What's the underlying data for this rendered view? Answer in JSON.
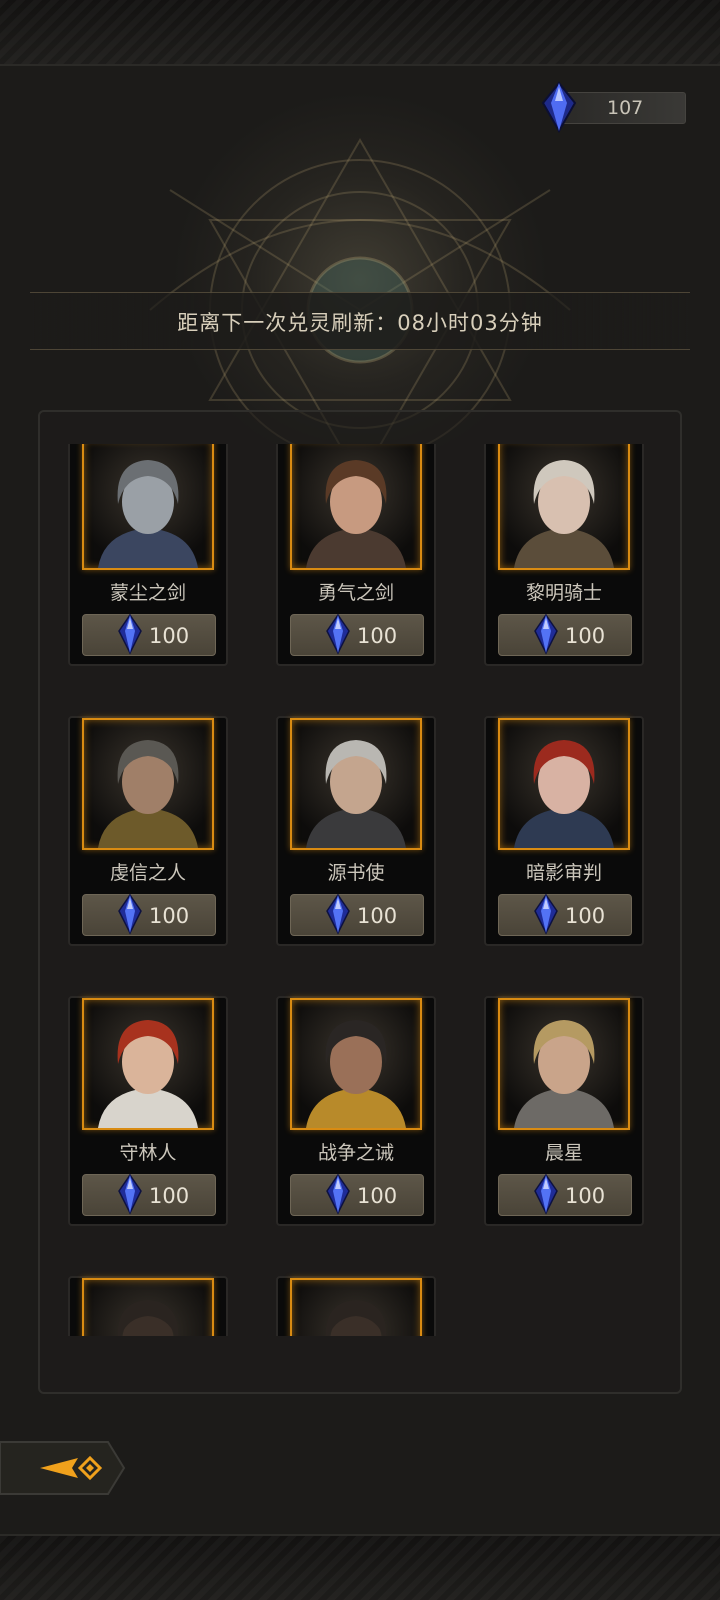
{
  "currency": {
    "icon": "blue-crystal-icon",
    "value": "107"
  },
  "refresh": {
    "text": "距离下一次兑灵刷新：08小时03分钟"
  },
  "cards": [
    {
      "name": "蒙尘之剑",
      "price": "100",
      "hair": "#6b6f73",
      "skin": "#9aa0a6",
      "accent": "#3b4660"
    },
    {
      "name": "勇气之剑",
      "price": "100",
      "hair": "#5a3a26",
      "skin": "#c79a80",
      "accent": "#4b3a30"
    },
    {
      "name": "黎明骑士",
      "price": "100",
      "hair": "#cfc8bd",
      "skin": "#d8c0b0",
      "accent": "#5b4d3a"
    },
    {
      "name": "虔信之人",
      "price": "100",
      "hair": "#5a5853",
      "skin": "#a07f68",
      "accent": "#6d5a2a"
    },
    {
      "name": "源书使",
      "price": "100",
      "hair": "#b9b7b2",
      "skin": "#c4a58e",
      "accent": "#3a3a3c"
    },
    {
      "name": "暗影审判",
      "price": "100",
      "hair": "#9c2a1e",
      "skin": "#d8b2a3",
      "accent": "#2e3a52"
    },
    {
      "name": "守林人",
      "price": "100",
      "hair": "#a8321e",
      "skin": "#dab49a",
      "accent": "#d8d4cc"
    },
    {
      "name": "战争之诫",
      "price": "100",
      "hair": "#2a2624",
      "skin": "#9a7058",
      "accent": "#b88a2a"
    },
    {
      "name": "晨星",
      "price": "100",
      "hair": "#b59a62",
      "skin": "#c9a48a",
      "accent": "#6d6a66"
    },
    {
      "name": "",
      "price": "",
      "hair": "#2a2420",
      "skin": "#3a2f28",
      "accent": "#201a16"
    },
    {
      "name": "",
      "price": "",
      "hair": "#2a2420",
      "skin": "#3a2f28",
      "accent": "#201a16"
    }
  ],
  "back": {
    "icon": "back-arrow-icon"
  }
}
